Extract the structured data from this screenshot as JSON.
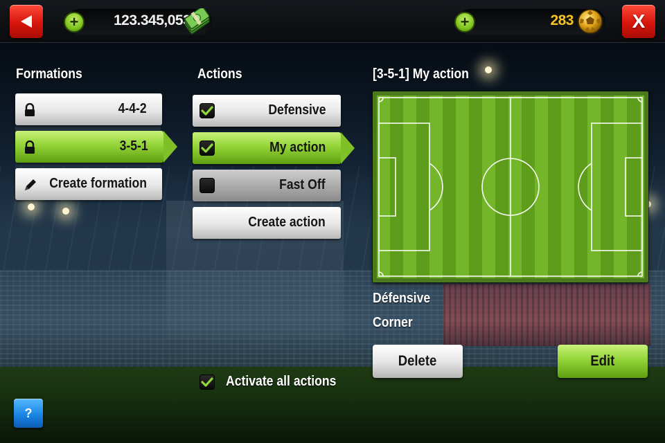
{
  "topbar": {
    "back_icon": "back-arrow-icon",
    "close_label": "X",
    "money_add": "+",
    "money_value": "123.345,053",
    "money_icon": "cash-icon",
    "coins_add": "+",
    "coins_value": "283",
    "coins_icon": "golden-ball-icon"
  },
  "formations": {
    "heading": "Formations",
    "items": [
      {
        "label": "4-4-2",
        "icon": "lock-icon",
        "selected": false
      },
      {
        "label": "3-5-1",
        "icon": "lock-icon",
        "selected": true
      },
      {
        "label": "Create formation",
        "icon": "pencil-icon",
        "selected": false
      }
    ]
  },
  "actions": {
    "heading": "Actions",
    "items": [
      {
        "label": "Defensive",
        "checked": true,
        "selected": false
      },
      {
        "label": "My action",
        "checked": true,
        "selected": true
      },
      {
        "label": "Fast Off",
        "checked": false,
        "selected": false,
        "dimmed": true
      },
      {
        "label": "Create action",
        "checked": null,
        "selected": false
      }
    ],
    "activate_all_label": "Activate all actions",
    "activate_all_checked": true
  },
  "detail": {
    "heading": "[3-5-1] My action",
    "line1": "Défensive",
    "line2": "Corner",
    "delete_label": "Delete",
    "edit_label": "Edit"
  },
  "help": {
    "label": "?"
  },
  "colors": {
    "accent_green": "#93d437",
    "accent_red": "#d6150b",
    "coins_gold": "#f5c323",
    "help_blue": "#1a86e6"
  }
}
